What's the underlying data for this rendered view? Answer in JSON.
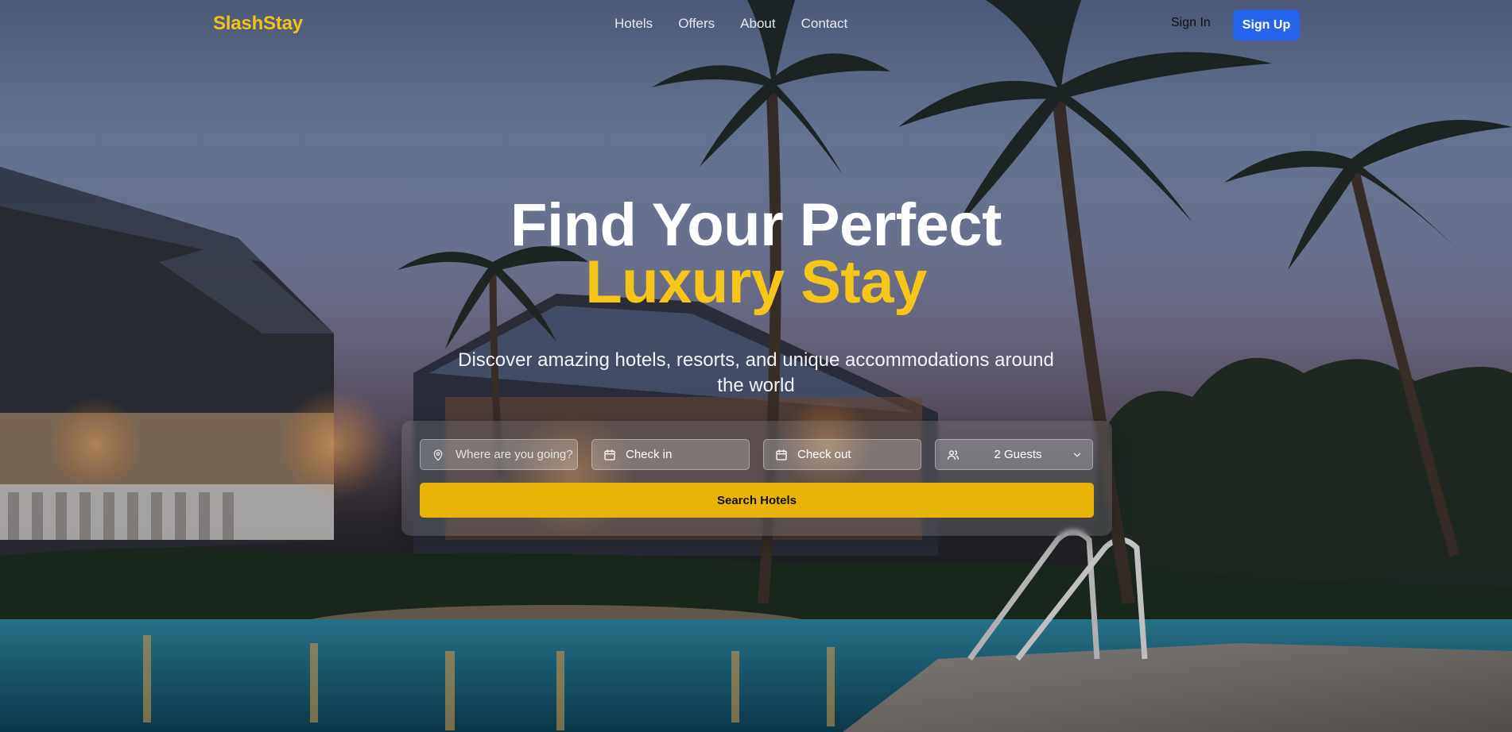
{
  "brand": {
    "name": "SlashStay",
    "accent_color": "#f5c518"
  },
  "nav": {
    "links": [
      {
        "label": "Hotels"
      },
      {
        "label": "Offers"
      },
      {
        "label": "About"
      },
      {
        "label": "Contact"
      }
    ],
    "sign_in": "Sign In",
    "sign_up": "Sign Up",
    "sign_up_color": "#2563eb"
  },
  "hero": {
    "headline_line1": "Find Your Perfect",
    "headline_line2": "Luxury Stay",
    "subtext": "Discover amazing hotels, resorts, and unique accommodations around the world",
    "background": "resort-pool-palm-trees-dusk"
  },
  "search": {
    "destination": {
      "placeholder": "Where are you going?",
      "value": "",
      "icon": "map-pin-icon"
    },
    "check_in": {
      "label": "Check in",
      "icon": "calendar-icon"
    },
    "check_out": {
      "label": "Check out",
      "icon": "calendar-icon"
    },
    "guests": {
      "value": "2 Guests",
      "icon": "users-icon"
    },
    "button_label": "Search Hotels",
    "button_color": "#eab308"
  }
}
